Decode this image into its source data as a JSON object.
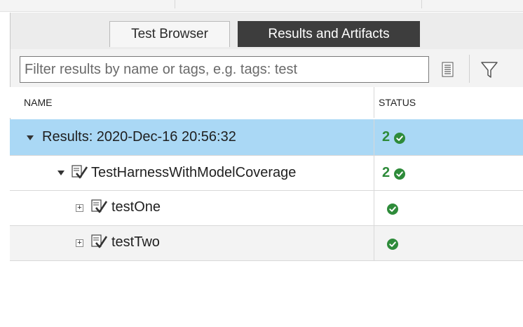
{
  "tabs": {
    "test_browser": "Test Browser",
    "results_artifacts": "Results and Artifacts",
    "active": "results_artifacts"
  },
  "filter": {
    "placeholder": "Filter results by name or tags, e.g. tags: test",
    "value": ""
  },
  "toolbar": {
    "list_icon": "list-icon",
    "filter_icon": "funnel-icon"
  },
  "columns": {
    "name": "NAME",
    "status": "STATUS"
  },
  "tree": [
    {
      "label": "Results: 2020-Dec-16 20:56:32",
      "passed_count": "2",
      "status": "passed",
      "expanded": true,
      "selected": true
    },
    {
      "label": "TestHarnessWithModelCoverage",
      "passed_count": "2",
      "status": "passed",
      "expanded": true
    },
    {
      "label": "testOne",
      "passed_count": "",
      "status": "passed",
      "expanded": false
    },
    {
      "label": "testTwo",
      "passed_count": "",
      "status": "passed",
      "expanded": false
    }
  ],
  "colors": {
    "selected_row": "#aad8f5",
    "pass_green": "#2e8b3a",
    "active_tab": "#3d3d3d"
  }
}
